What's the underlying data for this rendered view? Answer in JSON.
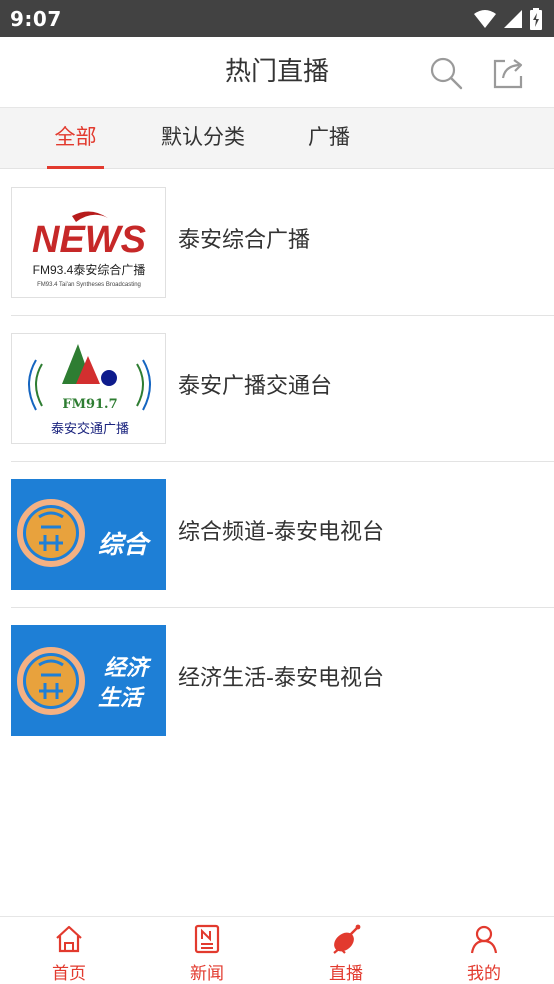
{
  "status_bar": {
    "time": "9:07"
  },
  "header": {
    "title": "热门直播"
  },
  "tabs": [
    {
      "label": "全部",
      "active": true
    },
    {
      "label": "默认分类",
      "active": false
    },
    {
      "label": "广播",
      "active": false
    }
  ],
  "items": [
    {
      "title": "泰安综合广播",
      "logo_main": "NEWS",
      "logo_sub": "FM93.4泰安综合广播",
      "logo_small": "FM93.4 Tai'an Syntheses Broadcasting"
    },
    {
      "title": "泰安广播交通台",
      "logo_freq": "FM91.7",
      "logo_sub": "泰安交通广播"
    },
    {
      "title": "综合频道-泰安电视台",
      "logo_text": "综合"
    },
    {
      "title": "经济生活-泰安电视台",
      "logo_text_1": "经济",
      "logo_text_2": "生活"
    }
  ],
  "bottom_nav": [
    {
      "label": "首页",
      "icon": "home-icon"
    },
    {
      "label": "新闻",
      "icon": "news-icon"
    },
    {
      "label": "直播",
      "icon": "live-icon"
    },
    {
      "label": "我的",
      "icon": "user-icon"
    }
  ],
  "colors": {
    "accent": "#e23a2e",
    "status_bar": "#424242",
    "tv_blue": "#1e7fd6"
  }
}
